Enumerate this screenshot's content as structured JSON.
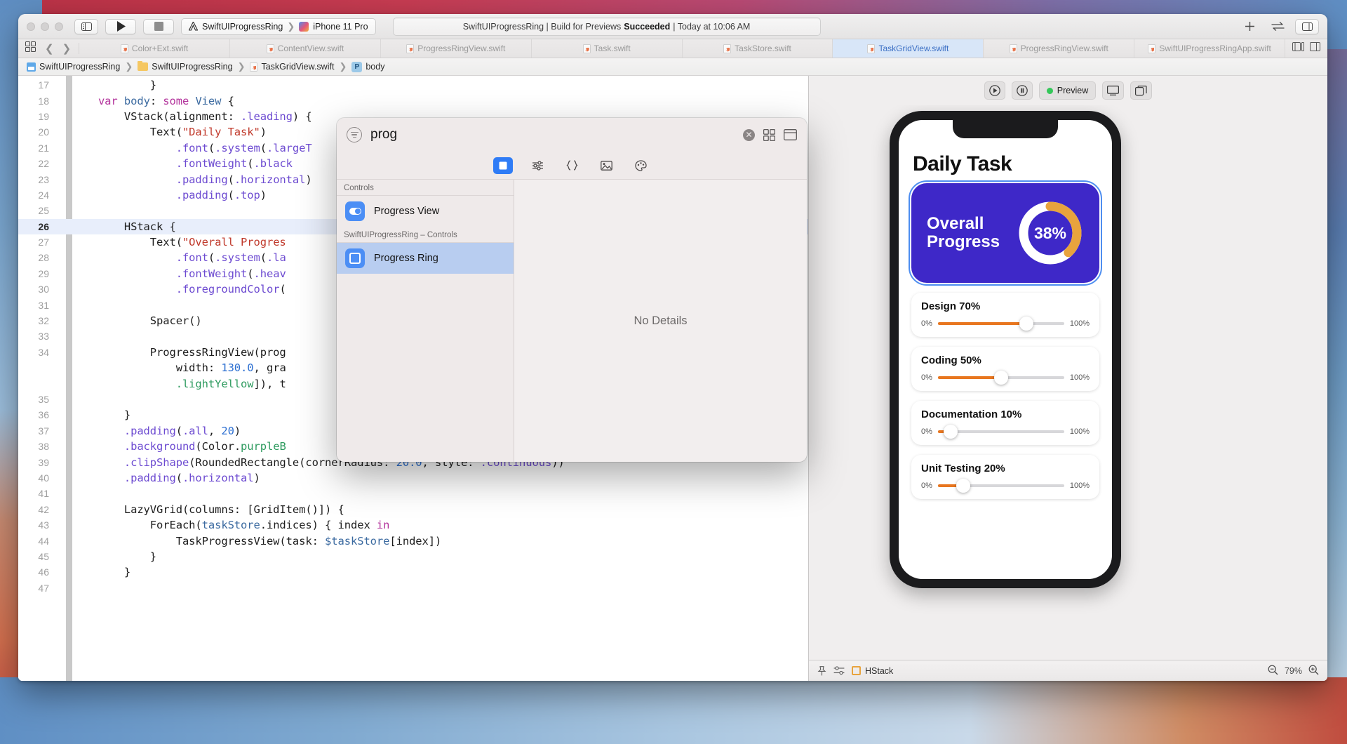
{
  "titlebar": {
    "scheme_project": "SwiftUIProgressRing",
    "scheme_device": "iPhone 11 Pro",
    "status_prefix": "SwiftUIProgressRing | Build for Previews ",
    "status_bold": "Succeeded",
    "status_suffix": " | Today at 10:06 AM",
    "run_icon": "play-icon",
    "stop_icon": "stop-icon",
    "sidebar_toggle_icon": "sidebar-toggle-icon",
    "add_icon": "add-icon",
    "swap_icon": "swap-editors-icon",
    "inspector_icon": "inspector-toggle-icon"
  },
  "tabbar": {
    "grid_icon": "tab-grid-icon",
    "back_icon": "chevron-left-icon",
    "forward_icon": "chevron-right-icon",
    "tabs": [
      {
        "label": "Color+Ext.swift",
        "active": false
      },
      {
        "label": "ContentView.swift",
        "active": false
      },
      {
        "label": "ProgressRingView.swift",
        "active": false
      },
      {
        "label": "Task.swift",
        "active": false
      },
      {
        "label": "TaskStore.swift",
        "active": false
      },
      {
        "label": "TaskGridView.swift",
        "active": true
      },
      {
        "label": "ProgressRingView.swift",
        "active": false
      },
      {
        "label": "SwiftUIProgressRingApp.swift",
        "active": false
      }
    ]
  },
  "breadcrumb": {
    "items": [
      "SwiftUIProgressRing",
      "SwiftUIProgressRing",
      "TaskGridView.swift",
      "body"
    ]
  },
  "editor": {
    "current_line": 26,
    "lines": [
      {
        "n": 17,
        "tokens": [
          {
            "t": "            }",
            "c": "id"
          }
        ]
      },
      {
        "n": 18,
        "tokens": [
          {
            "t": "    ",
            "c": "id"
          },
          {
            "t": "var",
            "c": "kw"
          },
          {
            "t": " ",
            "c": "id"
          },
          {
            "t": "body",
            "c": "ty"
          },
          {
            "t": ": ",
            "c": "id"
          },
          {
            "t": "some",
            "c": "kw"
          },
          {
            "t": " ",
            "c": "id"
          },
          {
            "t": "View",
            "c": "ty"
          },
          {
            "t": " {",
            "c": "id"
          }
        ]
      },
      {
        "n": 19,
        "tokens": [
          {
            "t": "        VStack(alignment: ",
            "c": "id"
          },
          {
            "t": ".leading",
            "c": "fn"
          },
          {
            "t": ") {",
            "c": "id"
          }
        ]
      },
      {
        "n": 20,
        "tokens": [
          {
            "t": "            Text(",
            "c": "id"
          },
          {
            "t": "\"Daily Task\"",
            "c": "str"
          },
          {
            "t": ")",
            "c": "id"
          }
        ]
      },
      {
        "n": 21,
        "tokens": [
          {
            "t": "                ",
            "c": "id"
          },
          {
            "t": ".font",
            "c": "fn"
          },
          {
            "t": "(",
            "c": "id"
          },
          {
            "t": ".system",
            "c": "fn"
          },
          {
            "t": "(",
            "c": "id"
          },
          {
            "t": ".largeT",
            "c": "fn"
          }
        ]
      },
      {
        "n": 22,
        "tokens": [
          {
            "t": "                ",
            "c": "id"
          },
          {
            "t": ".fontWeight",
            "c": "fn"
          },
          {
            "t": "(",
            "c": "id"
          },
          {
            "t": ".black",
            "c": "fn"
          }
        ]
      },
      {
        "n": 23,
        "tokens": [
          {
            "t": "                ",
            "c": "id"
          },
          {
            "t": ".padding",
            "c": "fn"
          },
          {
            "t": "(",
            "c": "id"
          },
          {
            "t": ".horizontal",
            "c": "fn"
          },
          {
            "t": ")",
            "c": "id"
          }
        ]
      },
      {
        "n": 24,
        "tokens": [
          {
            "t": "                ",
            "c": "id"
          },
          {
            "t": ".padding",
            "c": "fn"
          },
          {
            "t": "(",
            "c": "id"
          },
          {
            "t": ".top",
            "c": "fn"
          },
          {
            "t": ")",
            "c": "id"
          }
        ]
      },
      {
        "n": 25,
        "tokens": [
          {
            "t": "",
            "c": "id"
          }
        ]
      },
      {
        "n": 26,
        "tokens": [
          {
            "t": "        HStack {",
            "c": "id"
          }
        ]
      },
      {
        "n": 27,
        "tokens": [
          {
            "t": "            Text(",
            "c": "id"
          },
          {
            "t": "\"Overall Progres",
            "c": "str"
          }
        ]
      },
      {
        "n": 28,
        "tokens": [
          {
            "t": "                ",
            "c": "id"
          },
          {
            "t": ".font",
            "c": "fn"
          },
          {
            "t": "(",
            "c": "id"
          },
          {
            "t": ".system",
            "c": "fn"
          },
          {
            "t": "(",
            "c": "id"
          },
          {
            "t": ".la",
            "c": "fn"
          }
        ]
      },
      {
        "n": 29,
        "tokens": [
          {
            "t": "                ",
            "c": "id"
          },
          {
            "t": ".fontWeight",
            "c": "fn"
          },
          {
            "t": "(",
            "c": "id"
          },
          {
            "t": ".heav",
            "c": "fn"
          }
        ]
      },
      {
        "n": 30,
        "tokens": [
          {
            "t": "                ",
            "c": "id"
          },
          {
            "t": ".foregroundColor",
            "c": "fn"
          },
          {
            "t": "(",
            "c": "id"
          }
        ]
      },
      {
        "n": 31,
        "tokens": [
          {
            "t": "",
            "c": "id"
          }
        ]
      },
      {
        "n": 32,
        "tokens": [
          {
            "t": "            Spacer()",
            "c": "id"
          }
        ]
      },
      {
        "n": 33,
        "tokens": [
          {
            "t": "",
            "c": "id"
          }
        ]
      },
      {
        "n": 34,
        "tokens": [
          {
            "t": "            ProgressRingView(prog",
            "c": "id"
          }
        ]
      },
      {
        "n": null,
        "tokens": [
          {
            "t": "                width: ",
            "c": "id"
          },
          {
            "t": "130.0",
            "c": "num"
          },
          {
            "t": ", gra",
            "c": "id"
          }
        ]
      },
      {
        "n": null,
        "tokens": [
          {
            "t": "                ",
            "c": "id"
          },
          {
            "t": ".lightYellow",
            "c": "grn"
          },
          {
            "t": "]), t",
            "c": "id"
          }
        ]
      },
      {
        "n": 35,
        "tokens": [
          {
            "t": "",
            "c": "id"
          }
        ]
      },
      {
        "n": 36,
        "tokens": [
          {
            "t": "        }",
            "c": "id"
          }
        ]
      },
      {
        "n": 37,
        "tokens": [
          {
            "t": "        ",
            "c": "id"
          },
          {
            "t": ".padding",
            "c": "fn"
          },
          {
            "t": "(",
            "c": "id"
          },
          {
            "t": ".all",
            "c": "fn"
          },
          {
            "t": ", ",
            "c": "id"
          },
          {
            "t": "20",
            "c": "num"
          },
          {
            "t": ")",
            "c": "id"
          }
        ]
      },
      {
        "n": 38,
        "tokens": [
          {
            "t": "        ",
            "c": "id"
          },
          {
            "t": ".background",
            "c": "fn"
          },
          {
            "t": "(Color.",
            "c": "id"
          },
          {
            "t": "purpleB",
            "c": "grn"
          }
        ]
      },
      {
        "n": 39,
        "tokens": [
          {
            "t": "        ",
            "c": "id"
          },
          {
            "t": ".clipShape",
            "c": "fn"
          },
          {
            "t": "(RoundedRectangle(cornerRadius: ",
            "c": "id"
          },
          {
            "t": "20.0",
            "c": "num"
          },
          {
            "t": ", style: ",
            "c": "id"
          },
          {
            "t": ".continuous",
            "c": "fn"
          },
          {
            "t": "))",
            "c": "id"
          }
        ]
      },
      {
        "n": 40,
        "tokens": [
          {
            "t": "        ",
            "c": "id"
          },
          {
            "t": ".padding",
            "c": "fn"
          },
          {
            "t": "(",
            "c": "id"
          },
          {
            "t": ".horizontal",
            "c": "fn"
          },
          {
            "t": ")",
            "c": "id"
          }
        ]
      },
      {
        "n": 41,
        "tokens": [
          {
            "t": "",
            "c": "id"
          }
        ]
      },
      {
        "n": 42,
        "tokens": [
          {
            "t": "        LazyVGrid(columns: [GridItem()]) {",
            "c": "id"
          }
        ]
      },
      {
        "n": 43,
        "tokens": [
          {
            "t": "            ForEach(",
            "c": "id"
          },
          {
            "t": "taskStore",
            "c": "ty"
          },
          {
            "t": ".indices) { index ",
            "c": "id"
          },
          {
            "t": "in",
            "c": "kw"
          }
        ]
      },
      {
        "n": 44,
        "tokens": [
          {
            "t": "                TaskProgressView(task: ",
            "c": "id"
          },
          {
            "t": "$taskStore",
            "c": "ty"
          },
          {
            "t": "[index])",
            "c": "id"
          }
        ]
      },
      {
        "n": 45,
        "tokens": [
          {
            "t": "            }",
            "c": "id"
          }
        ]
      },
      {
        "n": 46,
        "tokens": [
          {
            "t": "        }",
            "c": "id"
          }
        ]
      },
      {
        "n": 47,
        "tokens": [
          {
            "t": "",
            "c": "id"
          }
        ]
      }
    ]
  },
  "library": {
    "query": "prog",
    "placeholder": "",
    "search_icon": "library-filter-icon",
    "clear_icon": "clear-search-icon",
    "grid_view_icon": "grid-view-icon",
    "detail_view_icon": "detail-view-icon",
    "tabs": [
      {
        "icon": "views-library-icon",
        "active": true
      },
      {
        "icon": "modifiers-library-icon",
        "active": false
      },
      {
        "icon": "snippets-library-icon",
        "active": false
      },
      {
        "icon": "media-library-icon",
        "active": false
      },
      {
        "icon": "color-library-icon",
        "active": false
      }
    ],
    "groups": [
      {
        "title": "Controls",
        "items": [
          {
            "label": "Progress View",
            "icon": "progress-view-icon",
            "selected": false
          }
        ]
      },
      {
        "title": "SwiftUIProgressRing – Controls",
        "items": [
          {
            "label": "Progress Ring",
            "icon": "progress-ring-icon",
            "selected": true
          }
        ]
      }
    ],
    "detail_empty_text": "No Details"
  },
  "preview": {
    "toolbar": {
      "play_icon": "preview-play-icon",
      "pause_icon": "preview-pause-icon",
      "live_label": "Preview",
      "device_icon": "preview-device-icon",
      "duplicate_icon": "preview-duplicate-icon"
    },
    "app": {
      "title": "Daily Task",
      "overall_label_line1": "Overall",
      "overall_label_line2": "Progress",
      "overall_percent": "38%",
      "overall_value": 38,
      "ring_track_color": "#ffffff",
      "ring_progress_color": "#e8a33d",
      "card_color": "#3e28c8",
      "tasks": [
        {
          "name": "Design",
          "percent": "70%",
          "value": 70,
          "min_label": "0%",
          "max_label": "100%"
        },
        {
          "name": "Coding",
          "percent": "50%",
          "value": 50,
          "min_label": "0%",
          "max_label": "100%"
        },
        {
          "name": "Documentation",
          "percent": "10%",
          "value": 10,
          "min_label": "0%",
          "max_label": "100%"
        },
        {
          "name": "Unit Testing",
          "percent": "20%",
          "value": 20,
          "min_label": "0%",
          "max_label": "100%"
        }
      ]
    },
    "statusbar": {
      "pin_icon": "pin-icon",
      "settings_icon": "preview-settings-icon",
      "selected_element": "HStack",
      "zoom_out_icon": "zoom-out-icon",
      "zoom_level": "79%",
      "zoom_in_icon": "zoom-in-icon"
    }
  }
}
